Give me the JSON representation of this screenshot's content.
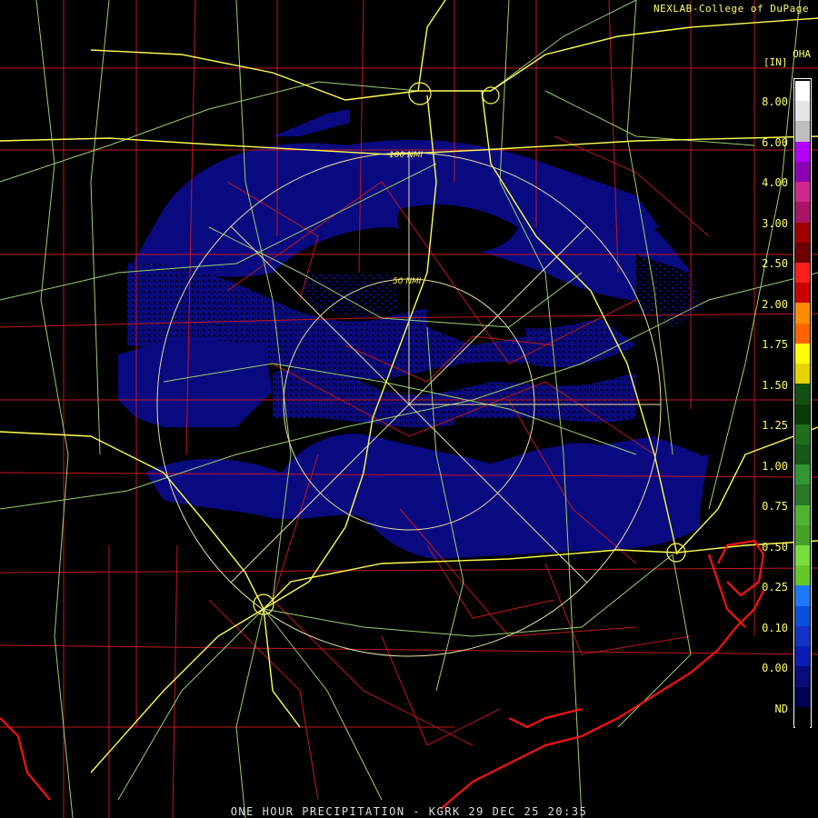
{
  "header": {
    "credit": "NEXLAB-College of DuPage",
    "product_code": "OHA",
    "units": "[IN]"
  },
  "footer": {
    "caption": "ONE HOUR PRECIPITATION - KGRK 29 DEC 25 20:35"
  },
  "range_rings": {
    "inner_label": "50 NMI",
    "outer_label": "100 NMI"
  },
  "legend": {
    "labels": [
      "8.00",
      "6.00",
      "4.00",
      "3.00",
      "2.50",
      "2.00",
      "1.75",
      "1.50",
      "1.25",
      "1.00",
      "0.75",
      "0.50",
      "0.25",
      "0.10",
      "0.00",
      "ND"
    ],
    "swatches": [
      "#ffffff",
      "#e6e6e6",
      "#bebebe",
      "#b400ff",
      "#8c00b4",
      "#d2288c",
      "#aa1464",
      "#a00000",
      "#6e0000",
      "#ff1e1e",
      "#c80000",
      "#ff8c00",
      "#ff6400",
      "#ffff00",
      "#e6d200",
      "#145014",
      "#0a3c0a",
      "#1e6e1e",
      "#145a14",
      "#329632",
      "#287828",
      "#50b432",
      "#46a028",
      "#78dc3c",
      "#64c828",
      "#1e78ff",
      "#0a50dc",
      "#1432c8",
      "#0a1eb4",
      "#0a0a78",
      "#000050",
      "#000000"
    ]
  },
  "colors": {
    "precip": "#0a0a80",
    "county_lines": "#c0181e",
    "highways": "#ffff50",
    "roads": "#9ad070",
    "coastline": "#ff1010",
    "rings": "#e8e0a0"
  }
}
